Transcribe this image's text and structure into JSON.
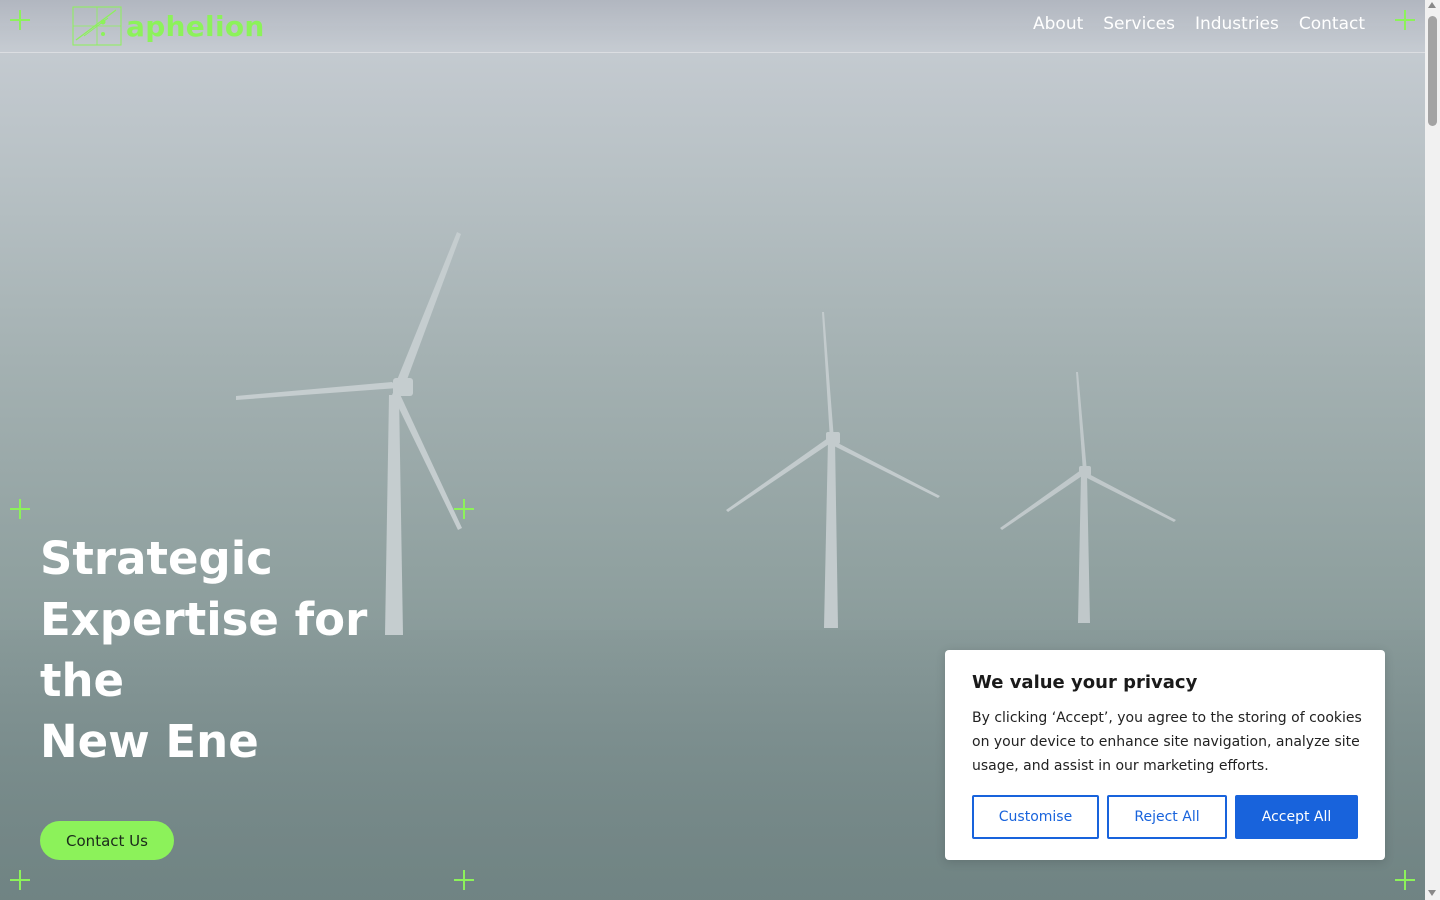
{
  "header": {
    "logo_text": "aphelion",
    "nav": [
      "About",
      "Services",
      "Industries",
      "Contact"
    ]
  },
  "hero": {
    "title_lines": [
      "Strategic",
      "Expertise for the",
      "New Ene"
    ],
    "cta_label": "Contact Us"
  },
  "cookie_banner": {
    "title": "We value your privacy",
    "body": "By clicking ‘Accept’, you agree to the storing of cookies on your device to enhance site navigation, analyze site usage, and assist in our marketing efforts.",
    "buttons": {
      "customise": "Customise",
      "reject": "Reject All",
      "accept": "Accept All"
    }
  },
  "colors": {
    "brand_green": "#8cf25a",
    "cookie_blue": "#1863dc"
  }
}
